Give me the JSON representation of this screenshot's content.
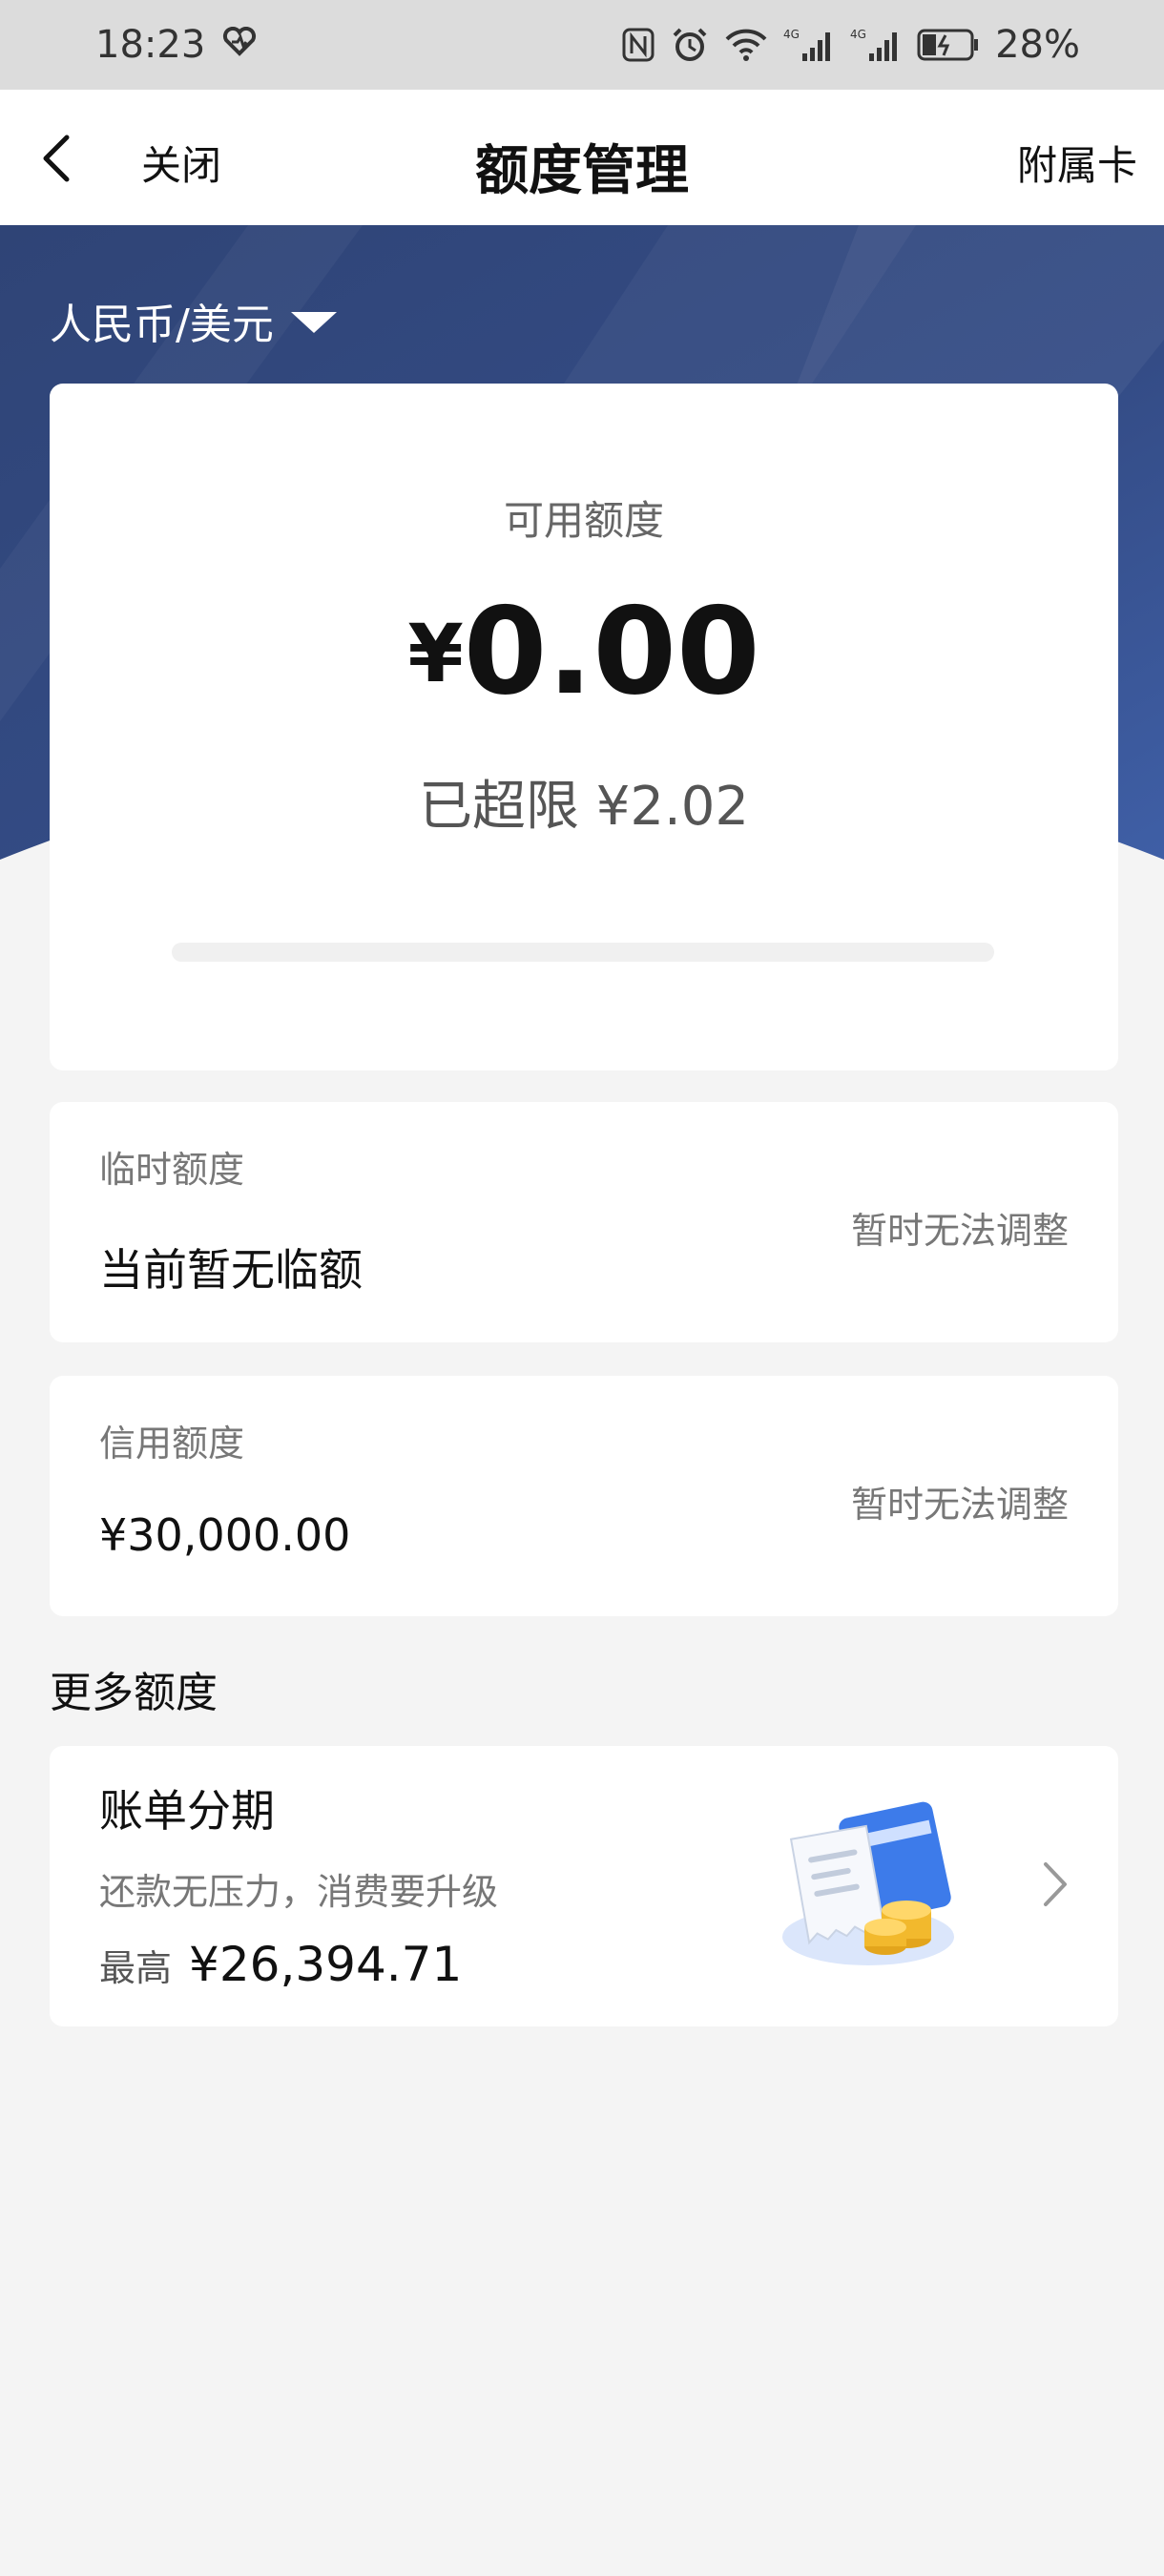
{
  "status_bar": {
    "time": "18:23",
    "battery": "28%",
    "icons": [
      "heart-pulse-icon",
      "nfc-icon",
      "alarm-icon",
      "wifi-icon",
      "signal-4g-icon",
      "signal-4g-icon",
      "battery-icon"
    ]
  },
  "nav": {
    "close_label": "关闭",
    "title": "额度管理",
    "right_label": "附属卡",
    "back_icon": "chevron-left-icon"
  },
  "currency_selector": {
    "label": "人民币/美元",
    "icon": "triangle-down-icon"
  },
  "available": {
    "label": "可用额度",
    "currency_symbol": "¥",
    "amount": "0.00",
    "over_limit": "已超限 ¥2.02",
    "usage_fraction": 0
  },
  "temp_limit": {
    "label": "临时额度",
    "value": "当前暂无临额",
    "action": "暂时无法调整"
  },
  "credit_limit": {
    "label": "信用额度",
    "value": "¥30,000.00",
    "action": "暂时无法调整"
  },
  "more": {
    "section_title": "更多额度",
    "installment": {
      "title": "账单分期",
      "desc": "还款无压力，消费要升级",
      "max_label": "最高",
      "max_value": "¥26,394.71",
      "icon": "bill-coins-icon",
      "chevron": "chevron-right-icon"
    }
  },
  "colors": {
    "hero_top": "#334a7d",
    "hero_bottom": "#3a5aa0",
    "page_bg": "#f4f4f4",
    "status_bg": "#dcdcdc"
  }
}
